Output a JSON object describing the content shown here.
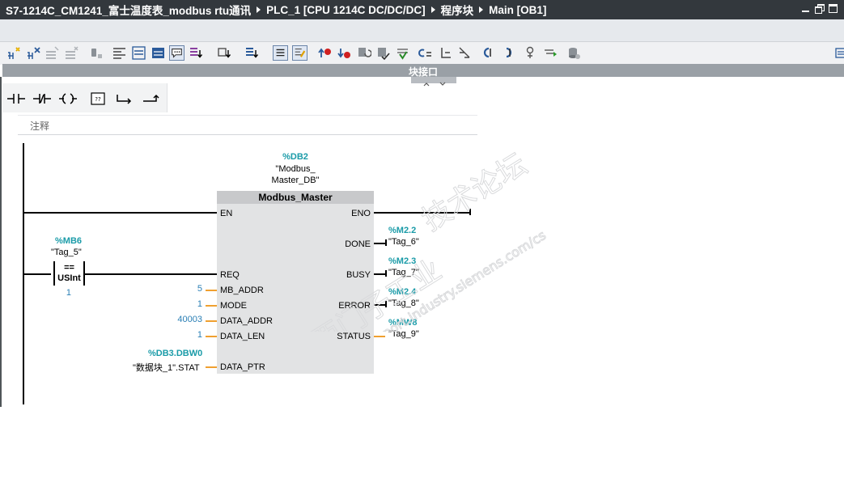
{
  "title_bar": {
    "crumbs": [
      "S7-1214C_CM1241_富士温度表_modbus rtu通讯",
      "PLC_1 [CPU 1214C DC/DC/DC]",
      "程序块",
      "Main [OB1]"
    ]
  },
  "toolbar": {
    "icons": [
      "insert-network-icon",
      "delete-network-icon",
      "insert-row-icon",
      "add-row-icon",
      "reset-start-values-icon",
      "open-all-networks-icon",
      "close-all-networks-icon",
      "expand-networks-icon",
      "network-comments-icon",
      "favorites-icon",
      "absolute-operands-icon",
      "show-tags-icon",
      "operand-display-icon",
      "toggle-view-icon",
      "go-to-previous-error-icon",
      "go-to-next-error-icon",
      "update-call-icon",
      "compile-icon",
      "monitoring-icon",
      "list-icon",
      "tree-icon",
      "jump-back-icon",
      "jump-forward-icon",
      "watch-icon",
      "force-icon",
      "database-icon"
    ]
  },
  "interface_bar": {
    "label": "块接口"
  },
  "palette": {
    "items": [
      "normally-open-contact-icon",
      "normally-closed-contact-icon",
      "output-coil-icon",
      "empty-box-icon",
      "open-branch-icon",
      "close-branch-icon"
    ]
  },
  "network": {
    "comment": "注释",
    "instance_db": {
      "address": "%DB2",
      "name_line1": "\"Modbus_",
      "name_line2": "Master_DB\""
    },
    "block": {
      "name": "Modbus_Master",
      "inputs": [
        "EN",
        "REQ",
        "MB_ADDR",
        "MODE",
        "DATA_ADDR",
        "DATA_LEN",
        "DATA_PTR"
      ],
      "outputs": [
        "ENO",
        "DONE",
        "BUSY",
        "ERROR",
        "STATUS"
      ]
    },
    "input_values": {
      "mb_addr": "5",
      "mode": "1",
      "data_addr": "40003",
      "data_len": "1",
      "data_ptr_addr": "%DB3.DBW0",
      "data_ptr_tag": "\"数据块_1\".STAT"
    },
    "comparator": {
      "operand_addr": "%MB6",
      "operand_tag": "\"Tag_5\"",
      "operator": "==",
      "type": "USInt",
      "compare_value": "1"
    },
    "output_tags": {
      "done_addr": "%M2.2",
      "done_tag": "\"Tag_6\"",
      "busy_addr": "%M2.3",
      "busy_tag": "\"Tag_7\"",
      "error_addr": "%M2.4",
      "error_tag": "\"Tag_8\"",
      "status_addr": "%MW8",
      "status_tag": "\"Tag_9\""
    }
  },
  "watermark": {
    "line1": "西门子工业",
    "line2": "技术论坛",
    "url": "support.industry.siemens.com/cs"
  },
  "colors": {
    "title_bg": "#33383d",
    "tag_address": "#1a9ba8",
    "value": "#2a7fb5",
    "param_wire": "#f0a030",
    "block_body": "#e2e3e4"
  }
}
